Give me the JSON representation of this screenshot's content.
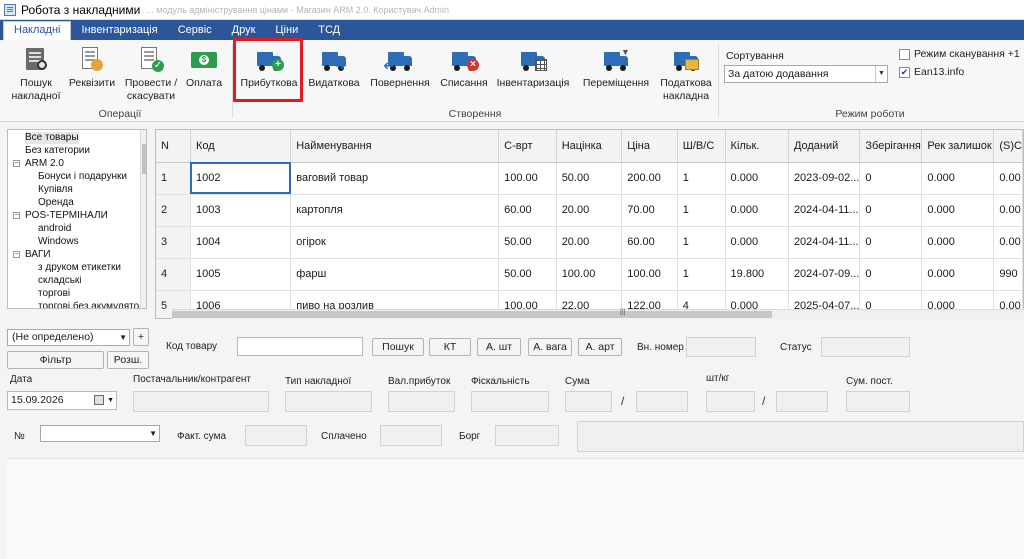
{
  "window": {
    "title": "Робота з накладними",
    "ghost_title": "... модуль адміністрування цінами - Магазин ARM 2.0. Користувач Admin"
  },
  "menu": {
    "tabs": [
      "Накладні",
      "Інвентаризація",
      "Сервіс",
      "Друк",
      "Ціни",
      "ТСД"
    ]
  },
  "ribbon": {
    "ops": {
      "search_label": "Пошук накладної",
      "requisites_label": "Реквізити",
      "post_label": "Провести / скасувати",
      "pay_label": "Оплата",
      "group_label": "Операції"
    },
    "create": {
      "income_label": "Прибуткова",
      "outcome_label": "Видаткова",
      "return_label": "Повернення",
      "writeoff_label": "Списання",
      "inventory_label": "Інвентаризація",
      "transfer_label": "Переміщення",
      "tax_label": "Податкова накладна",
      "group_label": "Створення"
    },
    "mode": {
      "sort_label": "Сортування",
      "sort_value": "За датою додавання",
      "scan_mode_label": "Режим сканування +1",
      "scan_mode_checked": false,
      "ean_label": "Ean13.info",
      "ean_checked": true,
      "group_label": "Режим роботи"
    },
    "highlighted_button": "Прибуткова",
    "highlight_color": "#e01b22"
  },
  "tree": {
    "items": [
      {
        "label": "Все товары",
        "level": 0,
        "selected": true
      },
      {
        "label": "Без категории",
        "level": 0
      },
      {
        "label": "ARM 2.0",
        "level": 0,
        "toggle": "−"
      },
      {
        "label": "Бонуси і подарунки",
        "level": 1
      },
      {
        "label": "Купівля",
        "level": 1
      },
      {
        "label": "Оренда",
        "level": 1
      },
      {
        "label": "POS-ТЕРМІНАЛИ",
        "level": 0,
        "toggle": "−"
      },
      {
        "label": "android",
        "level": 1
      },
      {
        "label": "Windows",
        "level": 1
      },
      {
        "label": "ВАГИ",
        "level": 0,
        "toggle": "−"
      },
      {
        "label": "з друком етикетки",
        "level": 1
      },
      {
        "label": "складські",
        "level": 1
      },
      {
        "label": "торгові",
        "level": 1
      },
      {
        "label": "торгові без акумулятора",
        "level": 1
      }
    ]
  },
  "grid": {
    "columns": [
      "N",
      "Код",
      "Найменування",
      "С-врт",
      "Націнка",
      "Ціна",
      "Ш/В/С",
      "Кільк.",
      "Доданий",
      "Зберігання",
      "Рек залишок",
      "(S)C"
    ],
    "rows": [
      [
        "1",
        "1002",
        "ваговий товар",
        "100.00",
        "50.00",
        "200.00",
        "1",
        "0.000",
        "2023-09-02...",
        "0",
        "0.000",
        "0.00"
      ],
      [
        "2",
        "1003",
        "картопля",
        "60.00",
        "20.00",
        "70.00",
        "1",
        "0.000",
        "2024-04-11...",
        "0",
        "0.000",
        "0.00"
      ],
      [
        "3",
        "1004",
        "огірок",
        "50.00",
        "20.00",
        "60.00",
        "1",
        "0.000",
        "2024-04-11...",
        "0",
        "0.000",
        "0.00"
      ],
      [
        "4",
        "1005",
        "фарш",
        "50.00",
        "100.00",
        "100.00",
        "1",
        "19.800",
        "2024-07-09...",
        "0",
        "0.000",
        "990"
      ],
      [
        "5",
        "1006",
        "пиво на розлив",
        "100.00",
        "22.00",
        "122.00",
        "4",
        "0.000",
        "2025-04-07...",
        "0",
        "0.000",
        "0.00"
      ]
    ]
  },
  "filter": {
    "category_value": "(Не определено)",
    "plus_label": "+",
    "filter_label": "Фільтр",
    "expand_label": "Розш."
  },
  "search": {
    "code_label": "Код товару",
    "find_label": "Пошук",
    "kt_label": "КТ",
    "a_pcs_label": "А. шт",
    "a_weight_label": "А. вага",
    "a_art_label": "А. арт",
    "ext_number_label": "Вн. номер",
    "status_label": "Статус"
  },
  "form": {
    "date_label": "Дата",
    "date_value": "15.09.2026",
    "supplier_label": "Постачальник/контрагент",
    "type_label": "Тип накладної",
    "curr_label": "Вал.прибуток",
    "fiscal_label": "Фіскальність",
    "sum_label": "Сума",
    "pcs_kg_label": "шт/кг",
    "sum_post_label": "Сум. пост.",
    "slash": "/",
    "number_label": "№",
    "fact_sum_label": "Факт. сума",
    "paid_label": "Сплачено",
    "debt_label": "Борг"
  },
  "colors": {
    "accent": "#2b579a",
    "truck_blue": "#2c6db5",
    "ok_green": "#2e9b4f",
    "cancel_red": "#d9342b"
  }
}
